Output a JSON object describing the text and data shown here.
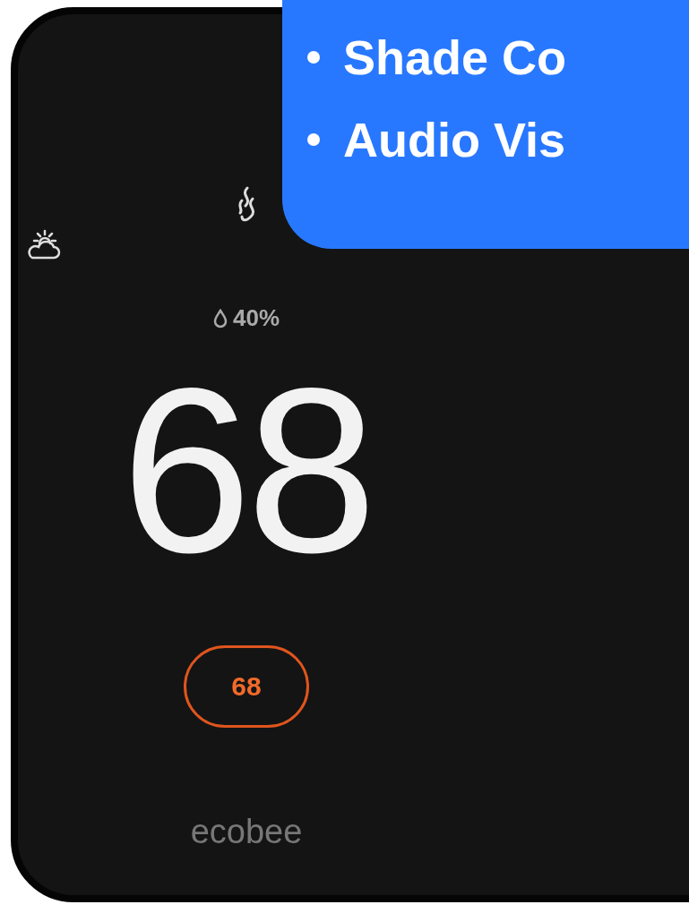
{
  "banner": {
    "items": [
      "Shade Co",
      "Audio Vis"
    ]
  },
  "thermostat": {
    "humidity": "40%",
    "temperature": "68",
    "setpoint": "68",
    "brand": "ecobee"
  }
}
